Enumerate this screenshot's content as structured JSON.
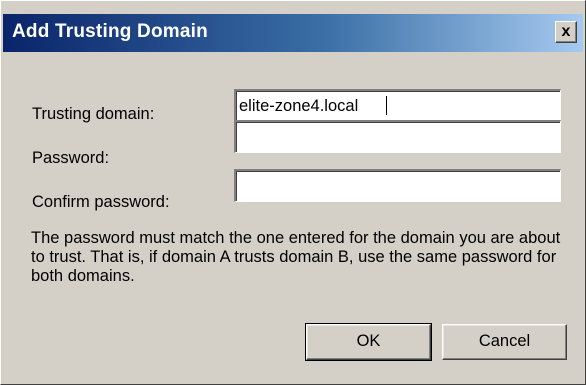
{
  "window": {
    "title": "Add Trusting Domain",
    "close_symbol": "x"
  },
  "form": {
    "trusting_domain_label": "Trusting domain:",
    "trusting_domain_value": "elite-zone4.local",
    "password_label": "Password:",
    "password_value": "",
    "confirm_password_label": "Confirm password:",
    "confirm_password_value": ""
  },
  "hint": "The password must match the one entered for the domain you are about to trust. That is, if domain A trusts domain B, use the same password for both domains.",
  "buttons": {
    "ok_label": "OK",
    "cancel_label": "Cancel"
  },
  "colors": {
    "title_gradient_start": "#0a246a",
    "title_gradient_end": "#a6caf0",
    "dialog_background": "#d4d0c8"
  },
  "icons": {
    "close": "close-icon"
  }
}
